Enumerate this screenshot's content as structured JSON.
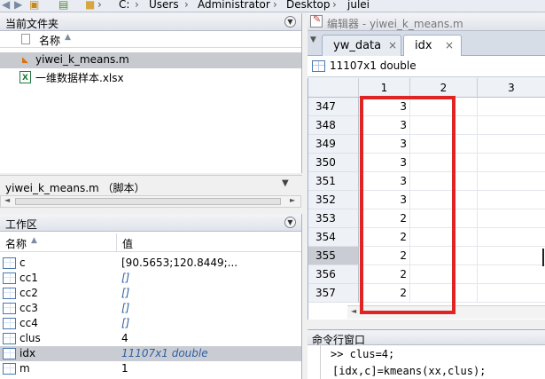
{
  "topbar": {
    "path": [
      "C:",
      "Users",
      "Administrator",
      "Desktop",
      "julei"
    ],
    "separator": "›"
  },
  "file_panel": {
    "title": "当前文件夹",
    "column_name": "名称",
    "files": [
      {
        "name": "yiwei_k_means.m",
        "selected": true
      },
      {
        "name": "一维数据样本.xlsx",
        "selected": false
      }
    ]
  },
  "detail": {
    "label": "yiwei_k_means.m （脚本）"
  },
  "workspace": {
    "title": "工作区",
    "col_name": "名称",
    "col_value": "值",
    "vars": [
      {
        "name": "c",
        "value": "[90.5653;120.8449;...",
        "italic": false
      },
      {
        "name": "cc1",
        "value": "[]",
        "italic": true
      },
      {
        "name": "cc2",
        "value": "[]",
        "italic": true
      },
      {
        "name": "cc3",
        "value": "[]",
        "italic": true
      },
      {
        "name": "cc4",
        "value": "[]",
        "italic": true
      },
      {
        "name": "clus",
        "value": "4",
        "italic": false
      },
      {
        "name": "idx",
        "value": "11107x1 double",
        "italic": true
      },
      {
        "name": "m",
        "value": "1",
        "italic": false
      }
    ]
  },
  "editor": {
    "title": "编辑器 - yiwei_k_means.m",
    "tabs": [
      {
        "label": "yw_data",
        "close": "×"
      },
      {
        "label": "idx",
        "close": "×"
      }
    ],
    "var_info": "11107x1 double"
  },
  "grid": {
    "columns": [
      "1",
      "2",
      "3"
    ],
    "rows": [
      {
        "index": "347",
        "value": "3"
      },
      {
        "index": "348",
        "value": "3"
      },
      {
        "index": "349",
        "value": "3"
      },
      {
        "index": "350",
        "value": "3"
      },
      {
        "index": "351",
        "value": "3"
      },
      {
        "index": "352",
        "value": "3"
      },
      {
        "index": "353",
        "value": "2"
      },
      {
        "index": "354",
        "value": "2"
      },
      {
        "index": "355",
        "value": "2"
      },
      {
        "index": "356",
        "value": "2"
      },
      {
        "index": "357",
        "value": "2"
      }
    ],
    "selected_row": "355"
  },
  "command": {
    "title": "命令行窗口",
    "lines": [
      ">> clus=4;",
      "[idx,c]=kmeans(xx,clus);"
    ]
  },
  "colors": {
    "highlight_box": "#e02424",
    "selection": "#c9cdd3",
    "italic_value": "#2f5fa3"
  }
}
